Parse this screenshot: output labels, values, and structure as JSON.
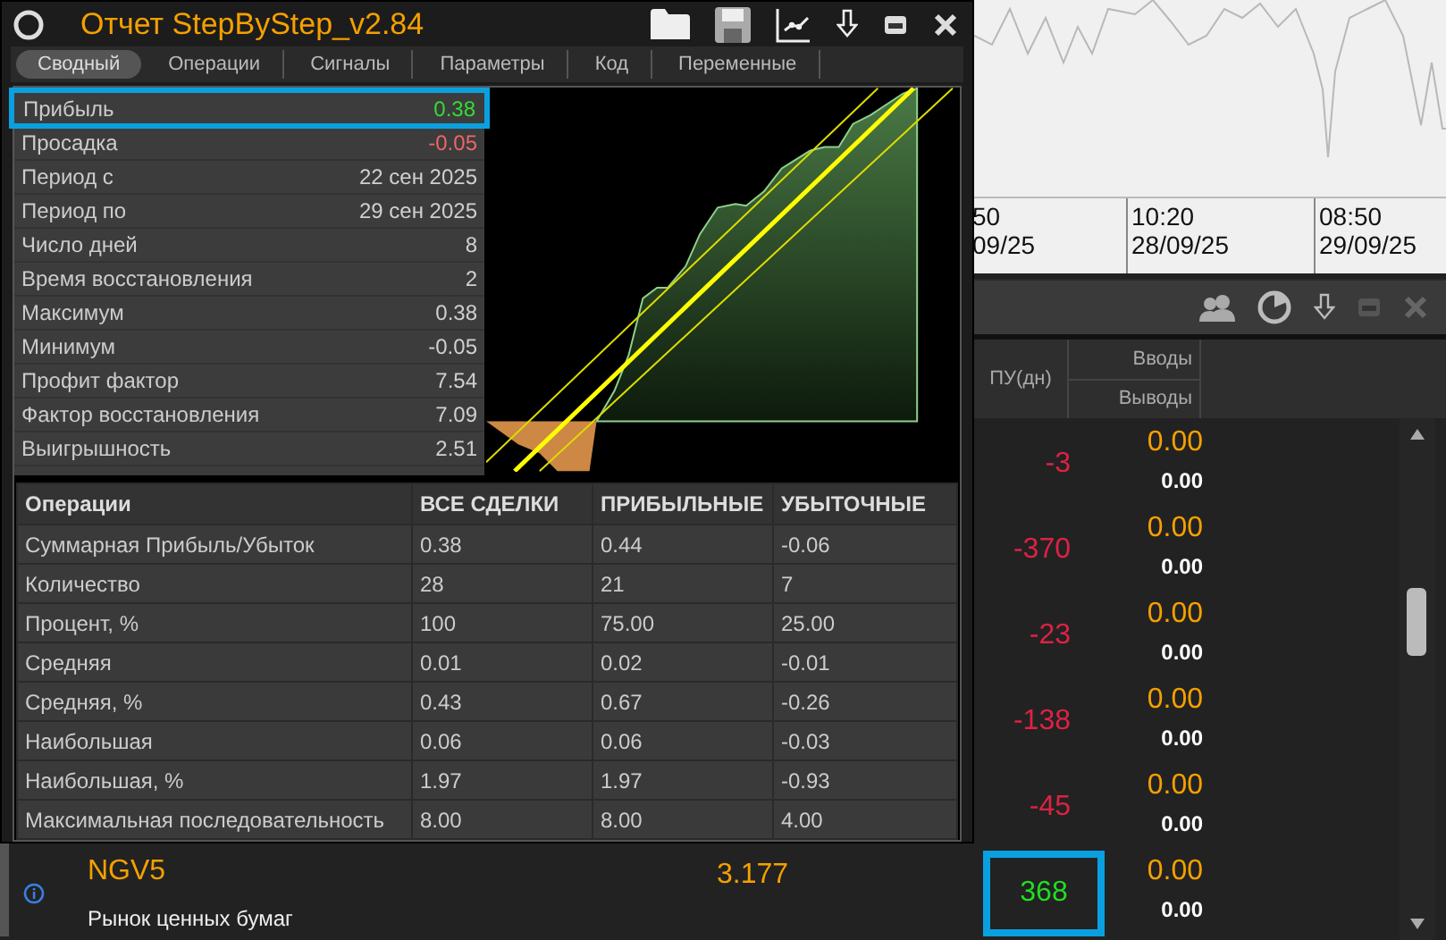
{
  "report_window": {
    "title": "Отчет StepByStep_v2.84",
    "tabs": [
      {
        "label": "Сводный",
        "selected": true
      },
      {
        "label": "Операции",
        "selected": false
      },
      {
        "label": "Сигналы",
        "selected": false
      },
      {
        "label": "Параметры",
        "selected": false
      },
      {
        "label": "Код",
        "selected": false
      },
      {
        "label": "Переменные",
        "selected": false
      }
    ],
    "stats": [
      {
        "label": "Прибыль",
        "value": "0.38",
        "color": "#33dd33",
        "highlighted": true
      },
      {
        "label": "Просадка",
        "value": "-0.05",
        "color": "#ee6666",
        "highlighted": false
      },
      {
        "label": "Период с",
        "value": "22 сен 2025",
        "color": "#d0d0d0",
        "highlighted": false
      },
      {
        "label": "Период по",
        "value": "29 сен 2025",
        "color": "#d0d0d0",
        "highlighted": false
      },
      {
        "label": "Число дней",
        "value": "8",
        "color": "#d0d0d0",
        "highlighted": false
      },
      {
        "label": "Время восстановления",
        "value": "2",
        "color": "#d0d0d0",
        "highlighted": false
      },
      {
        "label": "Максимум",
        "value": "0.38",
        "color": "#d0d0d0",
        "highlighted": false
      },
      {
        "label": "Минимум",
        "value": "-0.05",
        "color": "#d0d0d0",
        "highlighted": false
      },
      {
        "label": "Профит фактор",
        "value": "7.54",
        "color": "#d0d0d0",
        "highlighted": false
      },
      {
        "label": "Фактор восстановления",
        "value": "7.09",
        "color": "#d0d0d0",
        "highlighted": false
      },
      {
        "label": "Выигрышность",
        "value": "2.51",
        "color": "#d0d0d0",
        "highlighted": false
      }
    ],
    "table": {
      "columns": [
        "Операции",
        "ВСЕ СДЕЛКИ",
        "ПРИБЫЛЬНЫЕ",
        "УБЫТОЧНЫЕ"
      ],
      "rows": [
        [
          "Суммарная Прибыль/Убыток",
          "0.38",
          "0.44",
          "-0.06"
        ],
        [
          "Количество",
          "28",
          "21",
          "7"
        ],
        [
          "Процент, %",
          "100",
          "75.00",
          "25.00"
        ],
        [
          "Средняя",
          "0.01",
          "0.02",
          "-0.01"
        ],
        [
          "Средняя, %",
          "0.43",
          "0.67",
          "-0.26"
        ],
        [
          "Наибольшая",
          "0.06",
          "0.06",
          "-0.03"
        ],
        [
          "Наибольшая, %",
          "1.97",
          "1.97",
          "-0.93"
        ],
        [
          "Максимальная последовательность",
          "8.00",
          "8.00",
          "4.00"
        ]
      ]
    }
  },
  "price_chart": {
    "time_labels": [
      {
        "time": "50",
        "date": "09/25"
      },
      {
        "time": "10:20",
        "date": "28/09/25"
      },
      {
        "time": "08:50",
        "date": "29/09/25"
      }
    ]
  },
  "portfolio_panel": {
    "columns": {
      "pu": "ПУ(дн)",
      "in": "Вводы",
      "out": "Выводы"
    },
    "rows": [
      {
        "pu": "-3",
        "color": "#dd2244",
        "in": "0.00",
        "out": "0.00",
        "highlighted": false
      },
      {
        "pu": "-370",
        "color": "#dd2244",
        "in": "0.00",
        "out": "0.00",
        "highlighted": false
      },
      {
        "pu": "-23",
        "color": "#dd2244",
        "in": "0.00",
        "out": "0.00",
        "highlighted": false
      },
      {
        "pu": "-138",
        "color": "#dd2244",
        "in": "0.00",
        "out": "0.00",
        "highlighted": false
      },
      {
        "pu": "-45",
        "color": "#dd2244",
        "in": "0.00",
        "out": "0.00",
        "highlighted": false
      },
      {
        "name": "NGV5",
        "price": "3.177",
        "market": "Рынок ценных бумаг",
        "pu": "368",
        "color": "#22dd22",
        "in": "0.00",
        "out": "0.00",
        "highlighted": true
      }
    ]
  }
}
